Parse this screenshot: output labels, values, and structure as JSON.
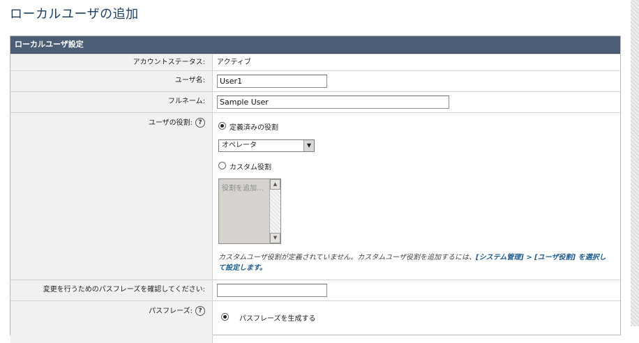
{
  "page": {
    "title": "ローカルユーザの追加"
  },
  "panel": {
    "header": "ローカルユーザ設定"
  },
  "fields": {
    "status": {
      "label": "アカウントステータス:",
      "value": "アクティブ"
    },
    "username": {
      "label": "ユーザ名:",
      "value": "User1"
    },
    "fullname": {
      "label": "フルネーム:",
      "value": "Sample User"
    },
    "role": {
      "label": "ユーザの役割:",
      "help": "?",
      "predefined_label": "定義済みの役割",
      "predefined_selected": true,
      "select_value": "オペレータ",
      "custom_label": "カスタム役割",
      "custom_selected": false,
      "list_placeholder": "役割を追加...",
      "note_text": "カスタムユーザ役割が定義されていません。カスタムユーザ役割を追加するには、",
      "note_link": "[システム管理] > [ユーザ役割] を選択して設定します。"
    },
    "confirm": {
      "label": "変更を行うためのパスフレーズを確認してください:",
      "value": ""
    },
    "passphrase": {
      "label": "パスフレーズ:",
      "help": "?",
      "generate_label": "パスフレーズを生成する",
      "generate_selected": true
    }
  },
  "icons": {
    "help": "help-icon",
    "select_arrow": "chevron-down-icon"
  },
  "colors": {
    "title": "#1c3d5e",
    "header_bg": "#4b5e75",
    "label_bg": "#f1f1f1",
    "link": "#1d5c8f"
  }
}
